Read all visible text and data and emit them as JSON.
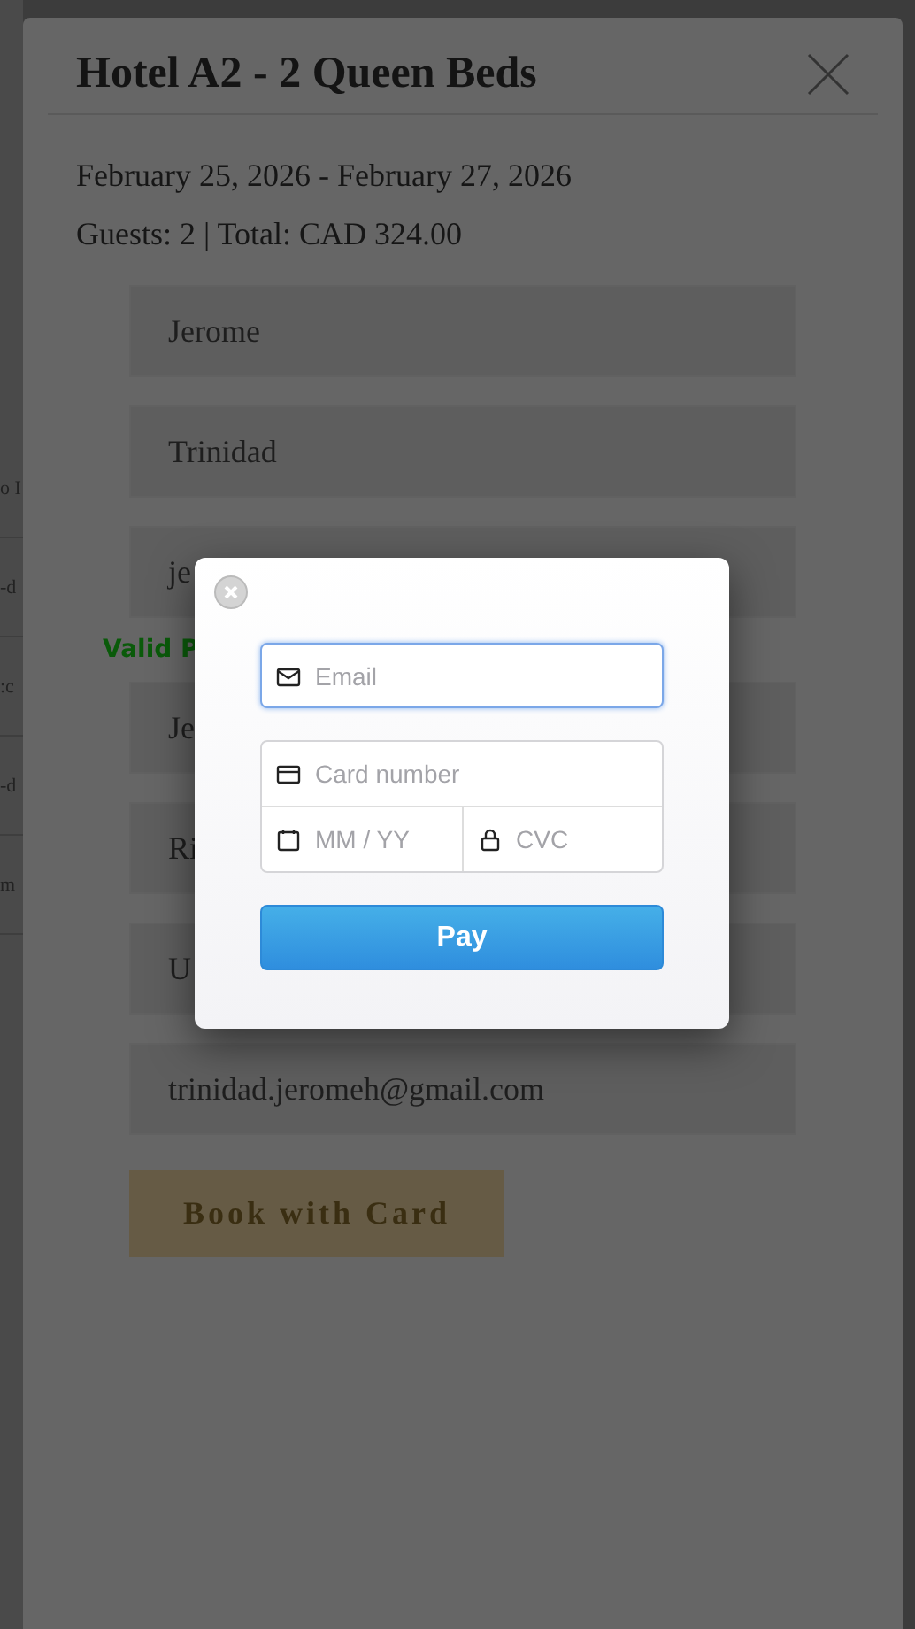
{
  "background_page": {
    "fragments": [
      "o I",
      "-d",
      ":c",
      "-d",
      "m"
    ]
  },
  "booking_dialog": {
    "title": "Hotel A2 - 2 Queen Beds",
    "dates": "February 25, 2026 - February 27, 2026",
    "summary": "Guests: 2 | Total: CAD 324.00",
    "rows": [
      {
        "kind": "field",
        "value": "Jerome"
      },
      {
        "kind": "field",
        "value": "Trinidad"
      },
      {
        "kind": "field",
        "value": "je"
      },
      {
        "kind": "note",
        "value": "Valid P"
      },
      {
        "kind": "field",
        "value": "Je"
      },
      {
        "kind": "field",
        "value": "Ri"
      },
      {
        "kind": "field",
        "value": "U"
      },
      {
        "kind": "field",
        "value": "trinidad.jeromeh@gmail.com"
      }
    ],
    "button": "Book with Card"
  },
  "payment_modal": {
    "email": {
      "placeholder": "Email",
      "focused": true
    },
    "card_number": {
      "placeholder": "Card number"
    },
    "expiry": {
      "placeholder": "MM / YY"
    },
    "cvc": {
      "placeholder": "CVC"
    },
    "button": "Pay"
  }
}
